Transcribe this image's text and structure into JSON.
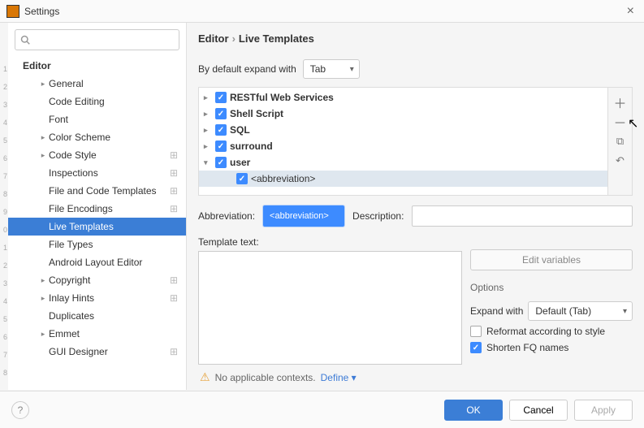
{
  "window": {
    "title": "Settings"
  },
  "breadcrumb": {
    "parent": "Editor",
    "current": "Live Templates"
  },
  "sidebar": {
    "root": "Editor",
    "items": [
      {
        "label": "General",
        "arrow": true,
        "gear": false
      },
      {
        "label": "Code Editing",
        "arrow": false,
        "gear": false
      },
      {
        "label": "Font",
        "arrow": false,
        "gear": false
      },
      {
        "label": "Color Scheme",
        "arrow": true,
        "gear": false
      },
      {
        "label": "Code Style",
        "arrow": true,
        "gear": true
      },
      {
        "label": "Inspections",
        "arrow": false,
        "gear": true
      },
      {
        "label": "File and Code Templates",
        "arrow": false,
        "gear": true
      },
      {
        "label": "File Encodings",
        "arrow": false,
        "gear": true
      },
      {
        "label": "Live Templates",
        "arrow": false,
        "gear": false,
        "selected": true
      },
      {
        "label": "File Types",
        "arrow": false,
        "gear": false
      },
      {
        "label": "Android Layout Editor",
        "arrow": false,
        "gear": false
      },
      {
        "label": "Copyright",
        "arrow": true,
        "gear": true
      },
      {
        "label": "Inlay Hints",
        "arrow": true,
        "gear": true
      },
      {
        "label": "Duplicates",
        "arrow": false,
        "gear": false
      },
      {
        "label": "Emmet",
        "arrow": true,
        "gear": false
      },
      {
        "label": "GUI Designer",
        "arrow": false,
        "gear": true
      }
    ]
  },
  "gutter": [
    "1",
    "2",
    "3",
    "4",
    "5",
    "6",
    "7",
    "8",
    "9",
    "0",
    "1",
    "2",
    "3",
    "4",
    "5",
    "6",
    "7",
    "8"
  ],
  "expand": {
    "label": "By default expand with",
    "value": "Tab"
  },
  "templates": {
    "groups": [
      {
        "label": "RESTful Web Services",
        "checked": true,
        "expanded": false
      },
      {
        "label": "Shell Script",
        "checked": true,
        "expanded": false
      },
      {
        "label": "SQL",
        "checked": true,
        "expanded": false
      },
      {
        "label": "surround",
        "checked": true,
        "expanded": false
      },
      {
        "label": "user",
        "checked": true,
        "expanded": true,
        "children": [
          {
            "label": "<abbreviation>",
            "checked": true
          }
        ]
      }
    ]
  },
  "form": {
    "abbrev_label": "Abbreviation:",
    "abbrev_value": "<abbreviation>",
    "desc_label": "Description:",
    "template_text_label": "Template text:",
    "edit_vars": "Edit variables"
  },
  "options": {
    "title": "Options",
    "expand_label": "Expand with",
    "expand_value": "Default (Tab)",
    "reformat": "Reformat according to style",
    "reformat_checked": false,
    "shorten": "Shorten FQ names",
    "shorten_checked": true
  },
  "context": {
    "warn": "No applicable contexts.",
    "define": "Define"
  },
  "footer": {
    "ok": "OK",
    "cancel": "Cancel",
    "apply": "Apply"
  }
}
